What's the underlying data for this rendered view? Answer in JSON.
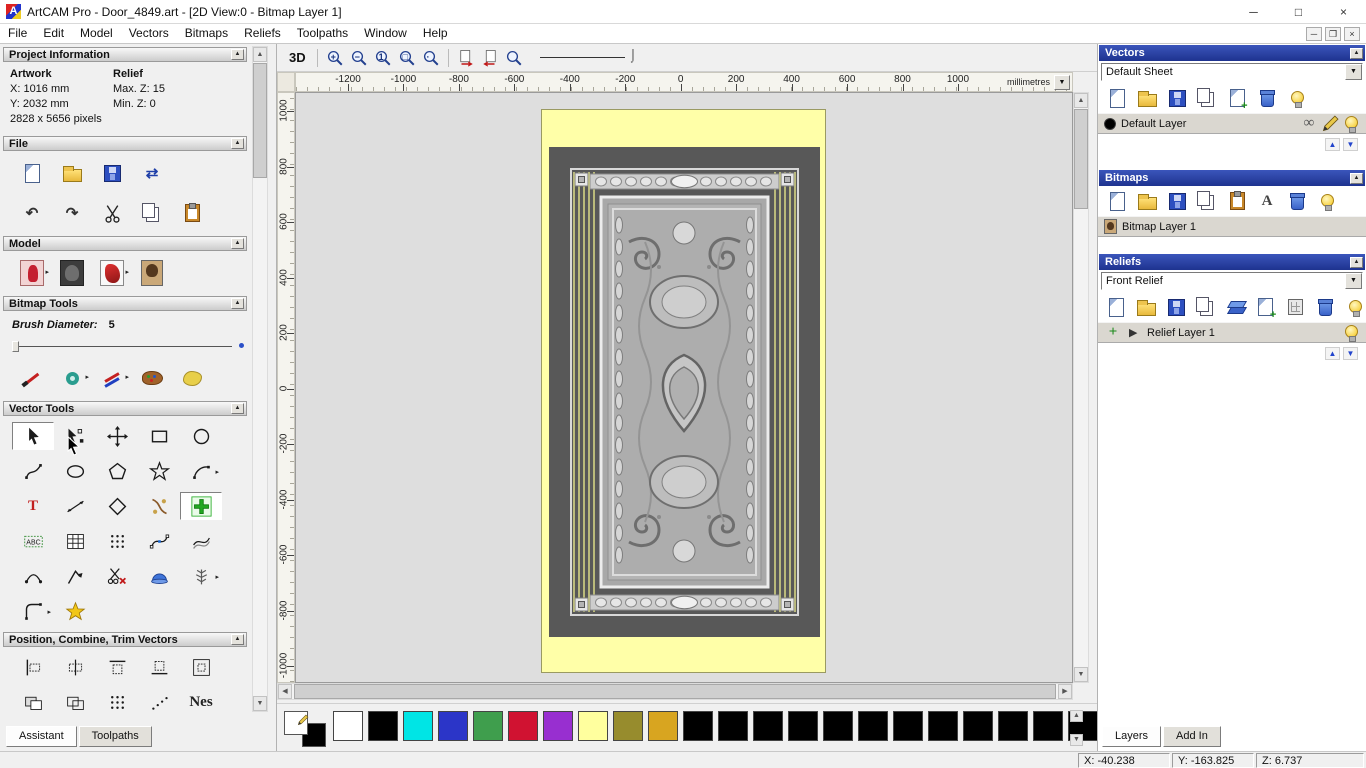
{
  "titlebar": {
    "title": "ArtCAM Pro - Door_4849.art - [2D View:0 - Bitmap Layer 1]",
    "controls": [
      "─",
      "□",
      "×"
    ]
  },
  "menubar": {
    "items": [
      "File",
      "Edit",
      "Model",
      "Vectors",
      "Bitmaps",
      "Reliefs",
      "Toolpaths",
      "Window",
      "Help"
    ],
    "mdi_controls": [
      "─",
      "❐",
      "×"
    ]
  },
  "left_panel": {
    "project_information_title": "Project Information",
    "project_info": {
      "artwork_header": "Artwork",
      "relief_header": "Relief",
      "x": "X: 1016 mm",
      "max_z": "Max. Z: 15",
      "y": "Y: 2032 mm",
      "min_z": "Min. Z: 0",
      "pixels": "2828 x 5656 pixels"
    },
    "file_title": "File",
    "file_row1": [
      "new-model",
      "open-model",
      "save-model",
      "import-model"
    ],
    "file_row2": [
      "undo",
      "redo",
      "cut",
      "copy",
      "paste"
    ],
    "model_title": "Model",
    "model_row": [
      "invert-model",
      "relief-preview",
      "stamp-model",
      "bitmap-image"
    ],
    "bitmap_tools_title": "Bitmap Tools",
    "brush_label": "Brush Diameter:",
    "brush_value": "5",
    "paint_row": [
      "paint-brush",
      "paint-selective",
      "pencil-pair",
      "colour-palette",
      "sponge"
    ],
    "vector_tools_title": "Vector Tools",
    "vector_rows": [
      [
        "select-vectors",
        "node-editing",
        "transform-vectors",
        "create-rectangle",
        "create-ellipse"
      ],
      [
        "create-polyline",
        "create-circle",
        "create-polygon",
        "create-star",
        "create-arc"
      ],
      [
        "create-text",
        "measure-tool",
        "create-diamond",
        "vector-doctor",
        "add-vectors"
      ],
      [
        "text-block",
        "bitmap-grid",
        "paste-array",
        "fit-arcs",
        "blend-curves"
      ],
      [
        "arc-segment",
        "join-polyline",
        "trim-tool",
        "extrude-dome",
        "texture-tree"
      ],
      [
        "fillet-tool",
        "wrap-star"
      ]
    ],
    "position_title": "Position, Combine, Trim Vectors",
    "position_rows": [
      [
        "align-left-tool",
        "align-centre-tool",
        "align-top-tool",
        "align-bottom-tool",
        "align-box-tool"
      ],
      [
        "combine-union-tool",
        "combine-subtract-tool",
        "scatter-dots-tool",
        "scatter-diag-tool",
        "nest-tool"
      ]
    ],
    "tabs": [
      {
        "label": "Assistant",
        "active": true
      },
      {
        "label": "Toolpaths",
        "active": false
      }
    ]
  },
  "selected_tools": [
    "select-vectors",
    "add-vectors"
  ],
  "dropdown_tools": [
    "invert-model",
    "stamp-model",
    "paint-selective",
    "pencil-pair",
    "create-arc",
    "texture-tree",
    "fillet-tool"
  ],
  "canvas": {
    "toolbar": {
      "view3d": "3D",
      "zoom_tools": [
        "zoom-in",
        "zoom-out",
        "zoom-100",
        "zoom-page",
        "zoom-selection"
      ],
      "snap_tools": [
        "snap-page-left",
        "snap-page-right"
      ],
      "extra_tools": [
        "zoom-info"
      ]
    },
    "ruler": {
      "h_start_mm": -1200,
      "h_end_mm": 1000,
      "v_start_mm": 1000,
      "v_end_mm": -1000,
      "step_mm": 200,
      "units": "millimetres"
    }
  },
  "palette": {
    "primary": "#ffffff",
    "secondary": "#000000",
    "colors": [
      "#ffffff",
      "#000000",
      "#00e5e5",
      "#2b35c8",
      "#3f9e4d",
      "#d01231",
      "#982fd0",
      "#ffff9e",
      "#978c2d",
      "#d8a520",
      "#000000",
      "#000000",
      "#000000",
      "#000000",
      "#000000",
      "#000000",
      "#000000",
      "#000000",
      "#000000",
      "#000000",
      "#000000",
      "#000000"
    ]
  },
  "right_panel": {
    "vectors": {
      "title": "Vectors",
      "sheet_selected": "Default Sheet",
      "layer_name": "Default Layer",
      "swatch": "#000000",
      "tools": [
        "new-vector-sheet",
        "open-vectors",
        "save-vectors",
        "copy-vectors",
        "paste-vectors",
        "delete-vector-layer",
        "toggle-vectors-visibility"
      ],
      "layer_tools": [
        "snap-layer",
        "edit-layer-colour",
        "layer-visibility"
      ]
    },
    "bitmaps": {
      "title": "Bitmaps",
      "layer_name": "Bitmap Layer 1",
      "tools": [
        "new-bitmap-layer",
        "open-bitmap",
        "save-bitmap",
        "copy-bitmap",
        "paste-bitmap",
        "greyscale-bitmap",
        "delete-bitmap-layer",
        "toggle-bitmaps-visibility"
      ]
    },
    "reliefs": {
      "title": "Reliefs",
      "relief_selected": "Front Relief",
      "layer_name": "Relief Layer 1",
      "tools": [
        "new-relief-layer",
        "open-relief",
        "save-relief",
        "copy-relief",
        "relief-stack",
        "paste-relief",
        "calculate-relief",
        "delete-relief-layer",
        "toggle-reliefs-visibility"
      ],
      "layer_tools": [
        "relief-add",
        "relief-expand"
      ]
    },
    "tabs": [
      {
        "label": "Layers",
        "active": true
      },
      {
        "label": "Add In",
        "active": false
      }
    ]
  },
  "statusbar": {
    "x": "X: -40.238",
    "y": "Y: -163.825",
    "z": "Z: 6.737"
  },
  "icon_map": {
    "new-model": "cls:ic-doc",
    "open-model": "cls:ic-folder",
    "save-model": "cls:ic-save",
    "import-model": "chr:⇄:#1f3fa8",
    "undo": "chr:↶:#333",
    "redo": "chr:↷:#333",
    "cut": "sym:scissors",
    "copy": "cls:ic-copy",
    "paste": "cls:ic-paste",
    "invert-model": "cls:ic-model1",
    "relief-preview": "cls:ic-model2",
    "stamp-model": "cls:ic-model3",
    "bitmap-image": "cls:ic-portrait-lg",
    "paint-brush": "cls:ic-brush",
    "paint-selective": "cls:ic-donut",
    "pencil-pair": "cls:ic-pencils",
    "colour-palette": "cls:ic-palette",
    "sponge": "cls:ic-sponge",
    "select-vectors": "sym:cursor",
    "node-editing": "sym:nodesel",
    "transform-vectors": "sym:xform",
    "create-rectangle": "sym:rect",
    "create-ellipse": "sym:circle",
    "create-polyline": "sym:polyline",
    "create-circle": "sym:ellipse",
    "create-polygon": "sym:polygon",
    "create-star": "sym:star",
    "create-arc": "sym:arc",
    "create-text": "chr:T:#c22020",
    "measure-tool": "sym:measure",
    "create-diamond": "sym:diamond",
    "vector-doctor": "sym:snip",
    "add-vectors": "sym:plusgreen",
    "text-block": "sym:abc",
    "bitmap-grid": "sym:grid",
    "paste-array": "sym:dots",
    "fit-arcs": "sym:nodecurve",
    "blend-curves": "sym:curves",
    "arc-segment": "sym:arcseg",
    "join-polyline": "sym:polyarrow",
    "trim-tool": "sym:scissx",
    "extrude-dome": "sym:dome",
    "texture-tree": "sym:tree",
    "fillet-tool": "sym:fillet",
    "wrap-star": "sym:staryellow",
    "align-left-tool": "sym:al",
    "align-centre-tool": "sym:ac",
    "align-top-tool": "sym:at",
    "align-bottom-tool": "sym:ab",
    "align-box-tool": "sym:abox",
    "combine-union-tool": "sym:c1",
    "combine-subtract-tool": "sym:c2",
    "scatter-dots-tool": "sym:dots",
    "scatter-diag-tool": "sym:c3",
    "nest-tool": "chr:Nes:#222",
    "zoom-in": "mag:+",
    "zoom-out": "mag:−",
    "zoom-100": "mag:1",
    "zoom-page": "mag:□",
    "zoom-selection": "mag:∙",
    "snap-page-left": "sym:pagearr",
    "snap-page-right": "sym:pagearr",
    "zoom-info": "mag:",
    "new-vector-sheet": "cls:ic-doc",
    "open-vectors": "cls:ic-folder",
    "save-vectors": "cls:ic-save",
    "copy-vectors": "cls:ic-copy",
    "paste-vectors": "cls:ic-docplus",
    "delete-vector-layer": "cls:ic-trash",
    "toggle-vectors-visibility": "cls:ic-bulb",
    "snap-layer": "chr:∞:#555",
    "edit-layer-colour": "sym:pen",
    "layer-visibility": "cls:ic-bulb",
    "new-bitmap-layer": "cls:ic-doc",
    "open-bitmap": "cls:ic-folder",
    "save-bitmap": "cls:ic-save",
    "copy-bitmap": "cls:ic-copy",
    "paste-bitmap": "cls:ic-paste",
    "greyscale-bitmap": "chr:A:#444",
    "delete-bitmap-layer": "cls:ic-trash",
    "toggle-bitmaps-visibility": "cls:ic-bulb",
    "new-relief-layer": "cls:ic-doc",
    "open-relief": "cls:ic-folder",
    "save-relief": "cls:ic-save",
    "copy-relief": "cls:ic-copy",
    "relief-stack": "cls:ic-layers",
    "paste-relief": "cls:ic-docplus",
    "calculate-relief": "cls:ic-calc",
    "delete-relief-layer": "cls:ic-trash",
    "toggle-reliefs-visibility": "cls:ic-bulb",
    "relief-add": "chr:+:#1a8a1a",
    "relief-expand": "chr:▸:#333",
    "bitmap-thumb": "cls:ic-portrait",
    "vector-layer-swatch": "cls:ic-blackdot",
    "relief-visibility": "cls:ic-bulb"
  }
}
